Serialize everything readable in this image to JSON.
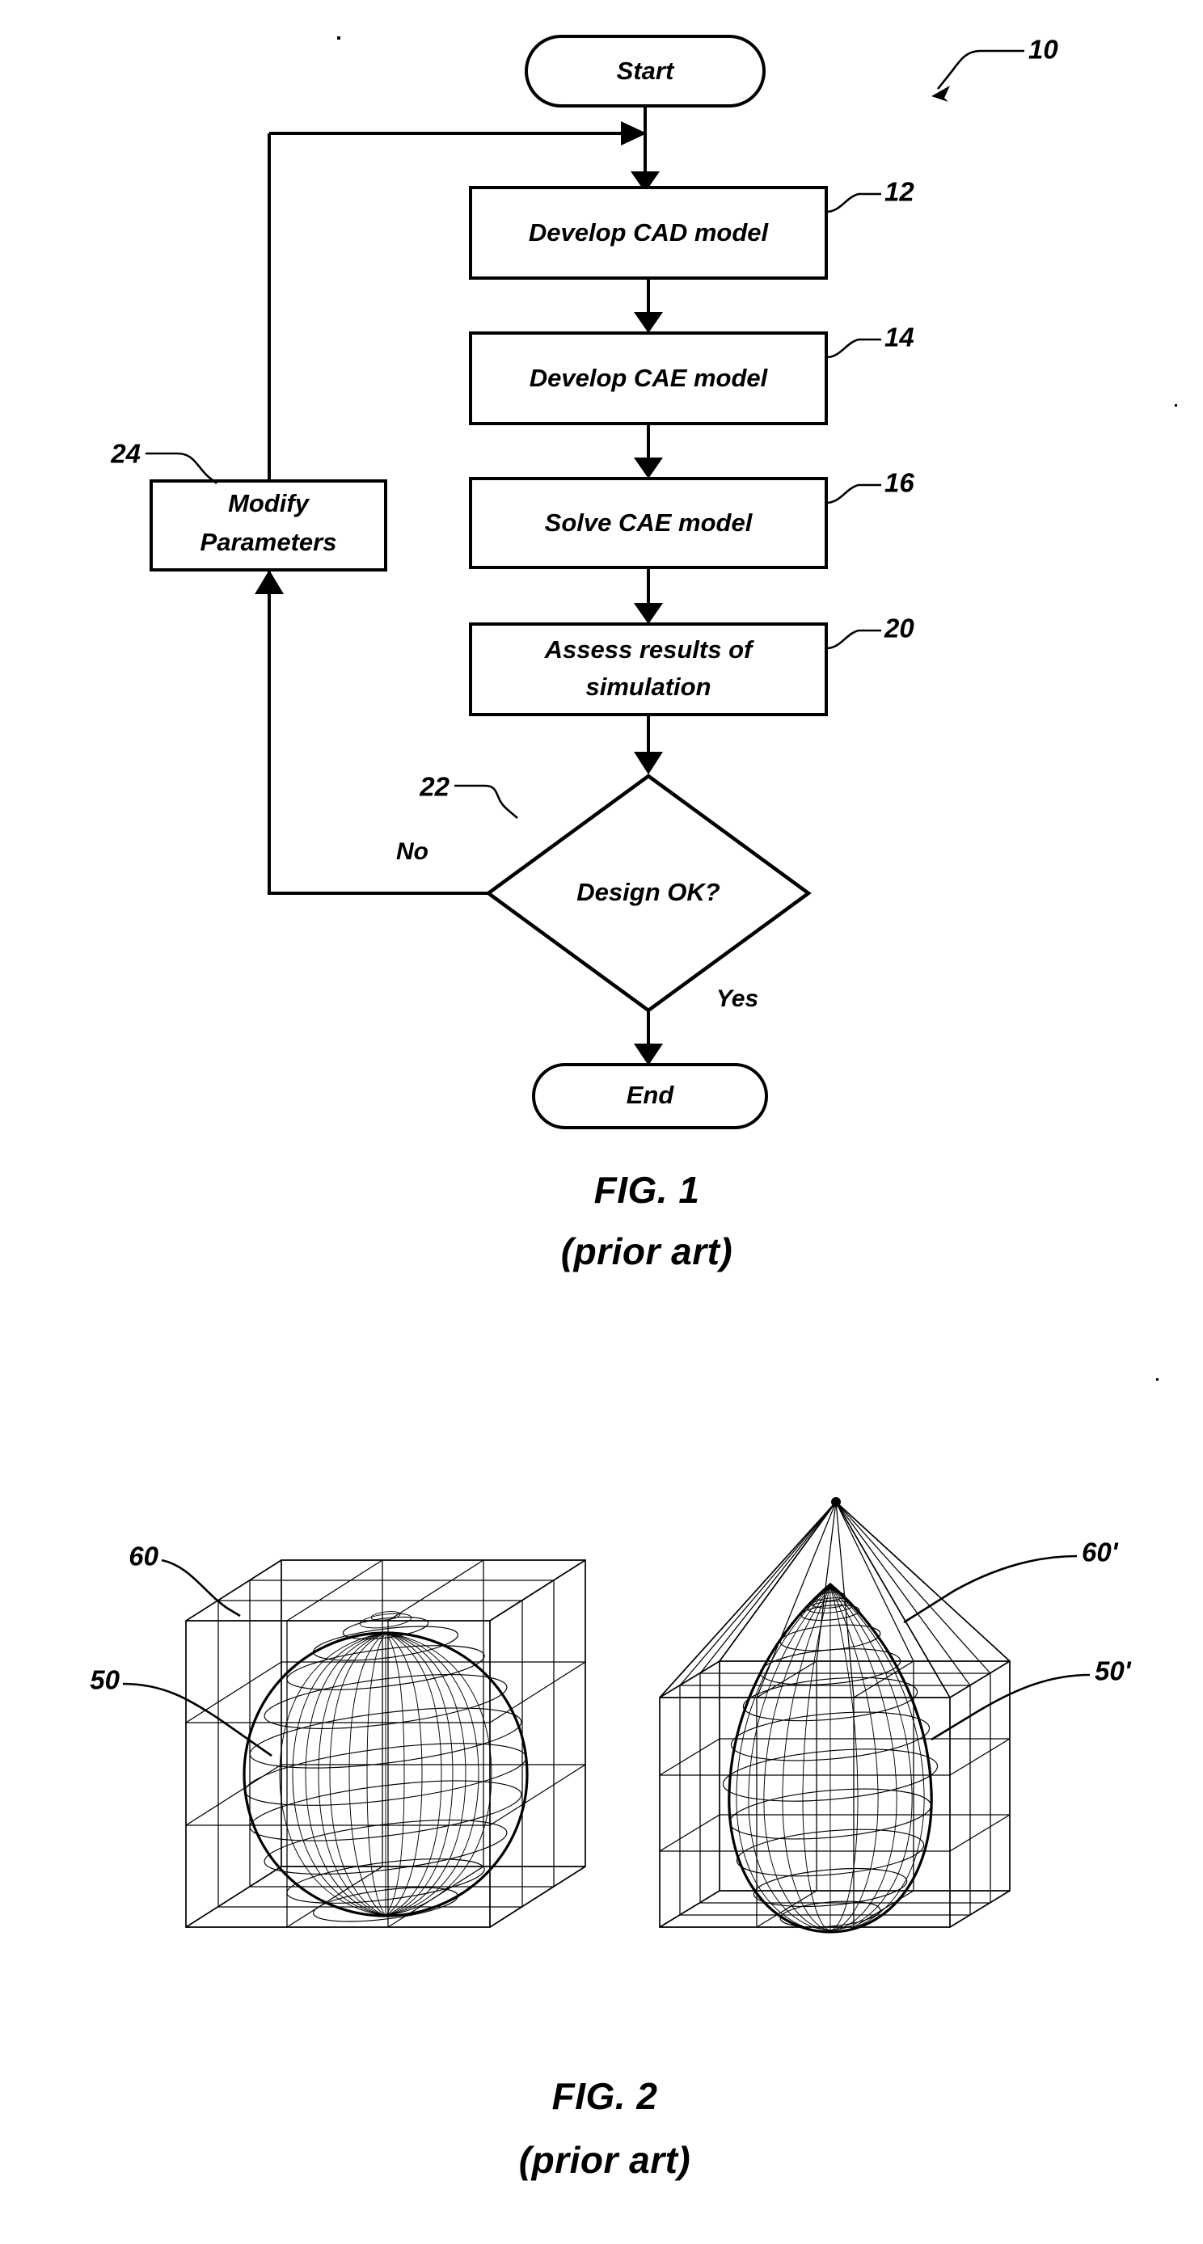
{
  "sheet": {
    "background_color": "#ffffff",
    "ink_color": "#000000"
  },
  "figure1": {
    "caption_line1": "FIG. 1",
    "caption_line2": "(prior art)",
    "overall_ref": "10",
    "nodes": [
      {
        "id": "start",
        "shape": "terminator",
        "label": "Start"
      },
      {
        "id": "cad",
        "shape": "process",
        "label": "Develop CAD model",
        "ref": "12"
      },
      {
        "id": "cae",
        "shape": "process",
        "label": "Develop CAE model",
        "ref": "14"
      },
      {
        "id": "solve",
        "shape": "process",
        "label": "Solve CAE model",
        "ref": "16"
      },
      {
        "id": "assess",
        "shape": "process",
        "label_line1": "Assess results of",
        "label_line2": "simulation",
        "ref": "20"
      },
      {
        "id": "decide",
        "shape": "decision",
        "label": "Design OK?",
        "ref": "22"
      },
      {
        "id": "modify",
        "shape": "process",
        "label_line1": "Modify",
        "label_line2": "Parameters",
        "ref": "24"
      },
      {
        "id": "end",
        "shape": "terminator",
        "label": "End"
      }
    ],
    "edge_labels": {
      "no": "No",
      "yes": "Yes"
    }
  },
  "figure2": {
    "caption_line1": "FIG. 2",
    "caption_line2": "(prior art)",
    "left_model": {
      "mesh_ref": "50",
      "cage_ref": "60",
      "shape_kind": "sphere",
      "cage_kind": "box-lattice"
    },
    "right_model": {
      "mesh_ref": "50'",
      "cage_ref": "60'",
      "shape_kind": "teardrop",
      "cage_kind": "box-lattice-with-apex"
    }
  }
}
